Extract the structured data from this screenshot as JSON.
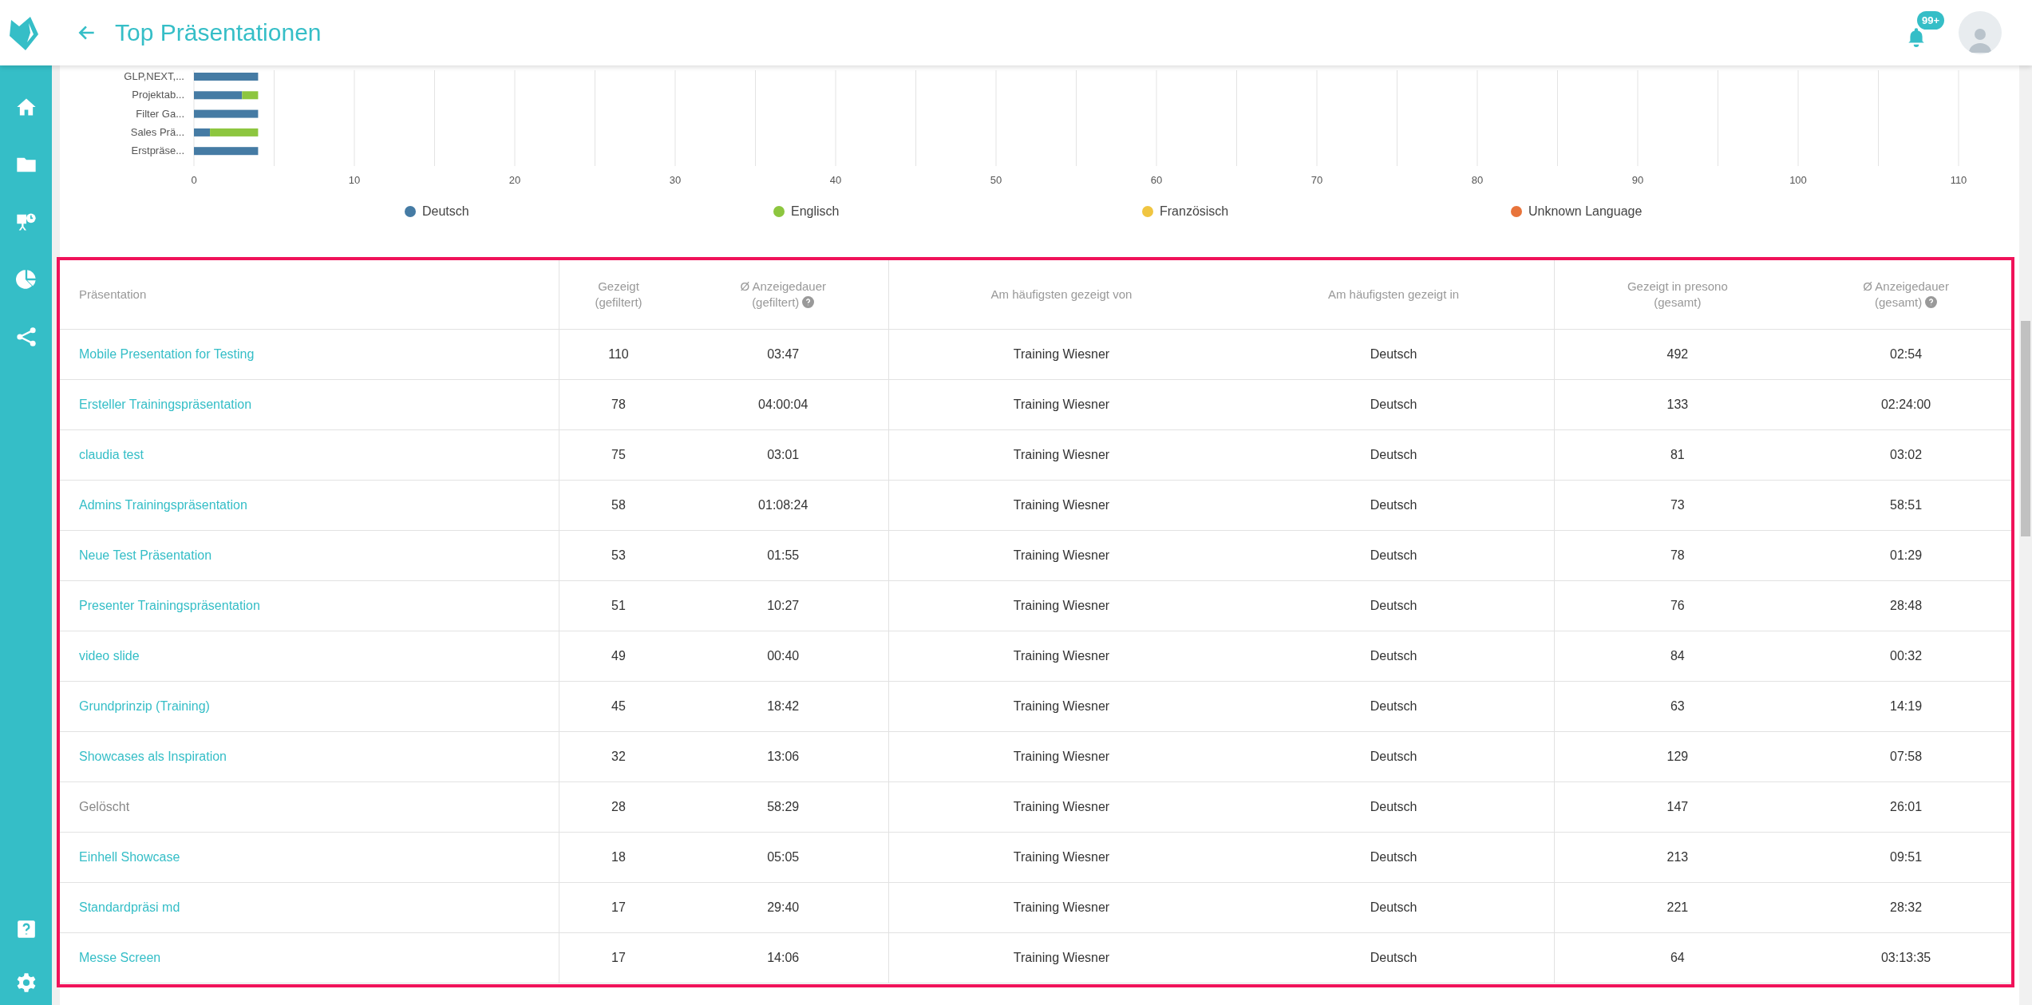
{
  "header": {
    "title": "Top Präsentationen",
    "notification_badge": "99+"
  },
  "sidebar": {
    "items": [
      {
        "kind": "home"
      },
      {
        "kind": "folder"
      },
      {
        "kind": "presentation"
      },
      {
        "kind": "pie"
      },
      {
        "kind": "share"
      }
    ],
    "bottom_items": [
      {
        "kind": "help"
      },
      {
        "kind": "settings"
      }
    ]
  },
  "chart": {
    "chart_data": {
      "type": "bar",
      "orientation": "horizontal",
      "stacked": true,
      "grid": true,
      "legend": "bottom",
      "categories": [
        "GLP,NEXT,...",
        "Projektab...",
        "Filter Ga...",
        "Sales Prä...",
        "Erstpräse..."
      ],
      "series": [
        {
          "name": "Deutsch",
          "color": "#457ba4",
          "values": [
            4,
            3,
            4,
            1,
            4
          ]
        },
        {
          "name": "Englisch",
          "color": "#8dc63f",
          "values": [
            0,
            1,
            0,
            3,
            0
          ]
        },
        {
          "name": "Französisch",
          "color": "#f0c541",
          "values": [
            0,
            0,
            0,
            0,
            0
          ]
        },
        {
          "name": "Unknown Language",
          "color": "#e8743b",
          "values": [
            0,
            0,
            0,
            0,
            0
          ]
        }
      ],
      "xlim": [
        0,
        110
      ],
      "xticks": [
        0,
        10,
        20,
        30,
        40,
        50,
        60,
        70,
        80,
        90,
        100,
        110
      ]
    }
  },
  "table": {
    "columns": [
      {
        "label": "Präsentation",
        "help": false
      },
      {
        "label": "Gezeigt",
        "sub": "(gefiltert)",
        "help": false
      },
      {
        "label": "Ø Anzeigedauer",
        "sub": "(gefiltert)",
        "help": true
      },
      {
        "label": "Am häufigsten gezeigt von",
        "help": false
      },
      {
        "label": "Am häufigsten gezeigt in",
        "help": false
      },
      {
        "label": "Gezeigt in presono",
        "sub": "(gesamt)",
        "help": false
      },
      {
        "label": "Ø Anzeigedauer",
        "sub": "(gesamt)",
        "help": true
      }
    ],
    "rows": [
      {
        "deleted": false,
        "cells": [
          "Mobile Presentation for Testing",
          "110",
          "03:47",
          "Training Wiesner",
          "Deutsch",
          "492",
          "02:54"
        ]
      },
      {
        "deleted": false,
        "cells": [
          "Ersteller Trainingspräsentation",
          "78",
          "04:00:04",
          "Training Wiesner",
          "Deutsch",
          "133",
          "02:24:00"
        ]
      },
      {
        "deleted": false,
        "cells": [
          "claudia test",
          "75",
          "03:01",
          "Training Wiesner",
          "Deutsch",
          "81",
          "03:02"
        ]
      },
      {
        "deleted": false,
        "cells": [
          "Admins Trainingspräsentation",
          "58",
          "01:08:24",
          "Training Wiesner",
          "Deutsch",
          "73",
          "58:51"
        ]
      },
      {
        "deleted": false,
        "cells": [
          "Neue Test Präsentation",
          "53",
          "01:55",
          "Training Wiesner",
          "Deutsch",
          "78",
          "01:29"
        ]
      },
      {
        "deleted": false,
        "cells": [
          "Presenter Trainingspräsentation",
          "51",
          "10:27",
          "Training Wiesner",
          "Deutsch",
          "76",
          "28:48"
        ]
      },
      {
        "deleted": false,
        "cells": [
          "video slide",
          "49",
          "00:40",
          "Training Wiesner",
          "Deutsch",
          "84",
          "00:32"
        ]
      },
      {
        "deleted": false,
        "cells": [
          "Grundprinzip (Training)",
          "45",
          "18:42",
          "Training Wiesner",
          "Deutsch",
          "63",
          "14:19"
        ]
      },
      {
        "deleted": false,
        "cells": [
          "Showcases als Inspiration",
          "32",
          "13:06",
          "Training Wiesner",
          "Deutsch",
          "129",
          "07:58"
        ]
      },
      {
        "deleted": true,
        "cells": [
          "Gelöscht",
          "28",
          "58:29",
          "Training Wiesner",
          "Deutsch",
          "147",
          "26:01"
        ]
      },
      {
        "deleted": false,
        "cells": [
          "Einhell Showcase",
          "18",
          "05:05",
          "Training Wiesner",
          "Deutsch",
          "213",
          "09:51"
        ]
      },
      {
        "deleted": false,
        "cells": [
          "Standardpräsi md",
          "17",
          "29:40",
          "Training Wiesner",
          "Deutsch",
          "221",
          "28:32"
        ]
      },
      {
        "deleted": false,
        "cells": [
          "Messe Screen",
          "17",
          "14:06",
          "Training Wiesner",
          "Deutsch",
          "64",
          "03:13:35"
        ]
      }
    ]
  }
}
